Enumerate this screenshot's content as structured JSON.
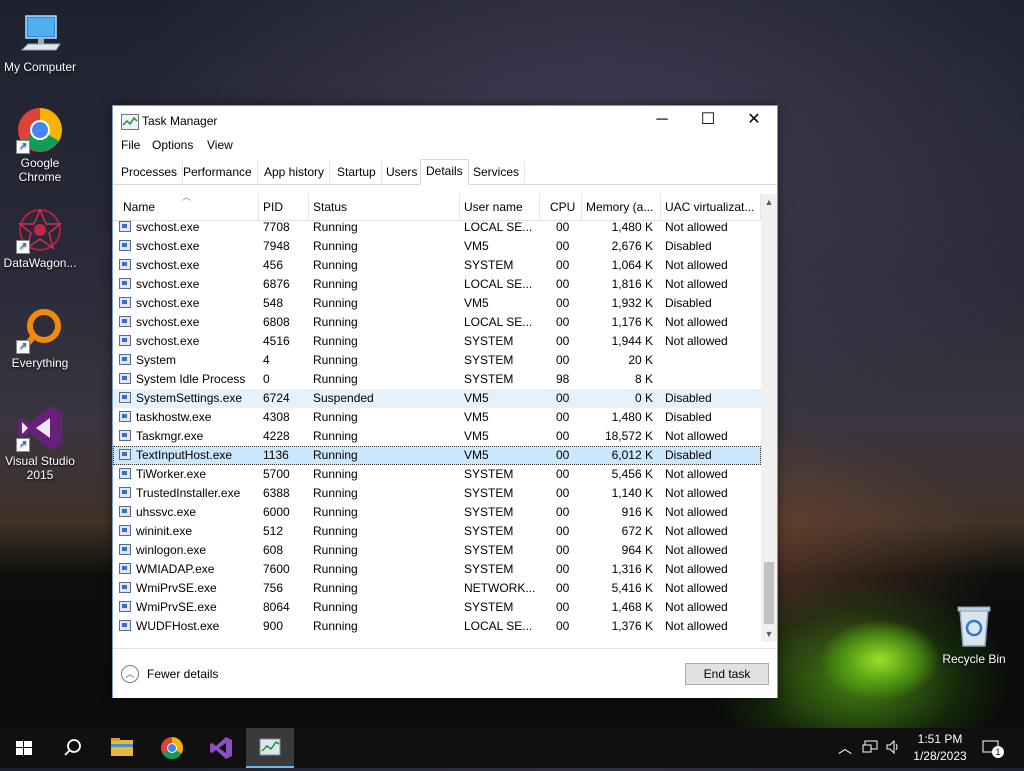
{
  "desktop": {
    "icons": [
      {
        "label": "My Computer"
      },
      {
        "label": "Google Chrome"
      },
      {
        "label": "DataWagon..."
      },
      {
        "label": "Everything"
      },
      {
        "label": "Visual Studio 2015"
      },
      {
        "label": "Recycle Bin"
      }
    ]
  },
  "window": {
    "title": "Task Manager",
    "menu": [
      "File",
      "Options",
      "View"
    ],
    "tabs": [
      "Processes",
      "Performance",
      "App history",
      "Startup",
      "Users",
      "Details",
      "Services"
    ],
    "active_tab": "Details",
    "columns": [
      "Name",
      "PID",
      "Status",
      "User name",
      "CPU",
      "Memory (a...",
      "UAC virtualizat..."
    ],
    "rows": [
      {
        "name": "svchost.exe",
        "pid": "7708",
        "status": "Running",
        "user": "LOCAL SE...",
        "cpu": "00",
        "mem": "1,480 K",
        "uac": "Not allowed"
      },
      {
        "name": "svchost.exe",
        "pid": "7948",
        "status": "Running",
        "user": "VM5",
        "cpu": "00",
        "mem": "2,676 K",
        "uac": "Disabled"
      },
      {
        "name": "svchost.exe",
        "pid": "456",
        "status": "Running",
        "user": "SYSTEM",
        "cpu": "00",
        "mem": "1,064 K",
        "uac": "Not allowed"
      },
      {
        "name": "svchost.exe",
        "pid": "6876",
        "status": "Running",
        "user": "LOCAL SE...",
        "cpu": "00",
        "mem": "1,816 K",
        "uac": "Not allowed"
      },
      {
        "name": "svchost.exe",
        "pid": "548",
        "status": "Running",
        "user": "VM5",
        "cpu": "00",
        "mem": "1,932 K",
        "uac": "Disabled"
      },
      {
        "name": "svchost.exe",
        "pid": "6808",
        "status": "Running",
        "user": "LOCAL SE...",
        "cpu": "00",
        "mem": "1,176 K",
        "uac": "Not allowed"
      },
      {
        "name": "svchost.exe",
        "pid": "4516",
        "status": "Running",
        "user": "SYSTEM",
        "cpu": "00",
        "mem": "1,944 K",
        "uac": "Not allowed"
      },
      {
        "name": "System",
        "pid": "4",
        "status": "Running",
        "user": "SYSTEM",
        "cpu": "00",
        "mem": "20 K",
        "uac": ""
      },
      {
        "name": "System Idle Process",
        "pid": "0",
        "status": "Running",
        "user": "SYSTEM",
        "cpu": "98",
        "mem": "8 K",
        "uac": ""
      },
      {
        "name": "SystemSettings.exe",
        "pid": "6724",
        "status": "Suspended",
        "user": "VM5",
        "cpu": "00",
        "mem": "0 K",
        "uac": "Disabled"
      },
      {
        "name": "taskhostw.exe",
        "pid": "4308",
        "status": "Running",
        "user": "VM5",
        "cpu": "00",
        "mem": "1,480 K",
        "uac": "Disabled"
      },
      {
        "name": "Taskmgr.exe",
        "pid": "4228",
        "status": "Running",
        "user": "VM5",
        "cpu": "00",
        "mem": "18,572 K",
        "uac": "Not allowed"
      },
      {
        "name": "TextInputHost.exe",
        "pid": "1136",
        "status": "Running",
        "user": "VM5",
        "cpu": "00",
        "mem": "6,012 K",
        "uac": "Disabled"
      },
      {
        "name": "TiWorker.exe",
        "pid": "5700",
        "status": "Running",
        "user": "SYSTEM",
        "cpu": "00",
        "mem": "5,456 K",
        "uac": "Not allowed"
      },
      {
        "name": "TrustedInstaller.exe",
        "pid": "6388",
        "status": "Running",
        "user": "SYSTEM",
        "cpu": "00",
        "mem": "1,140 K",
        "uac": "Not allowed"
      },
      {
        "name": "uhssvc.exe",
        "pid": "6000",
        "status": "Running",
        "user": "SYSTEM",
        "cpu": "00",
        "mem": "916 K",
        "uac": "Not allowed"
      },
      {
        "name": "wininit.exe",
        "pid": "512",
        "status": "Running",
        "user": "SYSTEM",
        "cpu": "00",
        "mem": "672 K",
        "uac": "Not allowed"
      },
      {
        "name": "winlogon.exe",
        "pid": "608",
        "status": "Running",
        "user": "SYSTEM",
        "cpu": "00",
        "mem": "964 K",
        "uac": "Not allowed"
      },
      {
        "name": "WMIADAP.exe",
        "pid": "7600",
        "status": "Running",
        "user": "SYSTEM",
        "cpu": "00",
        "mem": "1,316 K",
        "uac": "Not allowed"
      },
      {
        "name": "WmiPrvSE.exe",
        "pid": "756",
        "status": "Running",
        "user": "NETWORK...",
        "cpu": "00",
        "mem": "5,416 K",
        "uac": "Not allowed"
      },
      {
        "name": "WmiPrvSE.exe",
        "pid": "8064",
        "status": "Running",
        "user": "SYSTEM",
        "cpu": "00",
        "mem": "1,468 K",
        "uac": "Not allowed"
      },
      {
        "name": "WUDFHost.exe",
        "pid": "900",
        "status": "Running",
        "user": "LOCAL SE...",
        "cpu": "00",
        "mem": "1,376 K",
        "uac": "Not allowed"
      }
    ],
    "hovered_row": "SystemSettings.exe",
    "selected_row": "TextInputHost.exe",
    "footer": {
      "fewer_details": "Fewer details",
      "end_task": "End task"
    }
  },
  "taskbar": {
    "time": "1:51 PM",
    "date": "1/28/2023",
    "notification_count": "1"
  }
}
